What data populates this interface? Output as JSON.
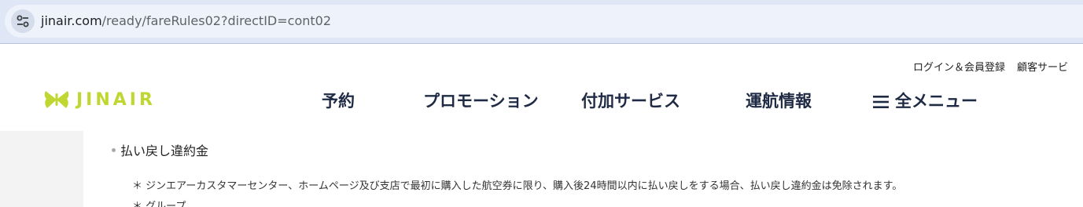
{
  "browser": {
    "url_host": "jinair.com",
    "url_path": "/ready/fareRules02?directID=cont02",
    "site_info_icon": "tune-icon"
  },
  "header": {
    "logo_text": "JINAIR",
    "logo_color": "#bfd730",
    "utility_links": [
      "ログイン＆会員登録",
      "顧客サービ"
    ],
    "nav": [
      "予約",
      "プロモーション",
      "付加サービス",
      "運航情報",
      "全メニュー"
    ],
    "menu_icon": "hamburger-icon"
  },
  "content": {
    "section_title": "払い戻し違約金",
    "note": "＊ ジンエアーカスタマーセンター、ホームページ及び支店で最初に購入した航空券に限り、購入後24時間以内に払い戻しをする場合、払い戻し違約金は免除されます。",
    "note_partial": "＊ グループ…"
  }
}
